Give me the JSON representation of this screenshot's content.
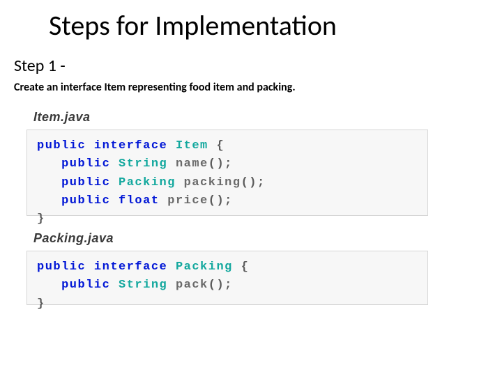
{
  "title": "Steps for Implementation",
  "step": {
    "label": "Step 1 -",
    "description": "Create an interface Item representing food item and packing."
  },
  "files": [
    {
      "filename": "Item.java",
      "code": {
        "kw_public": "public",
        "kw_interface": "interface",
        "cls_item": "Item",
        "br_open": "{",
        "ret_string": "String",
        "m_name": "name",
        "parens": "();",
        "ret_packing": "Packing",
        "m_packing": "packing",
        "kw_float": "float",
        "m_price": "price",
        "br_close": "}"
      }
    },
    {
      "filename": "Packing.java",
      "code": {
        "kw_public": "public",
        "kw_interface": "interface",
        "cls_packing": "Packing",
        "br_open": "{",
        "ret_string": "String",
        "m_pack": "pack",
        "parens": "();",
        "br_close": "}"
      }
    }
  ]
}
